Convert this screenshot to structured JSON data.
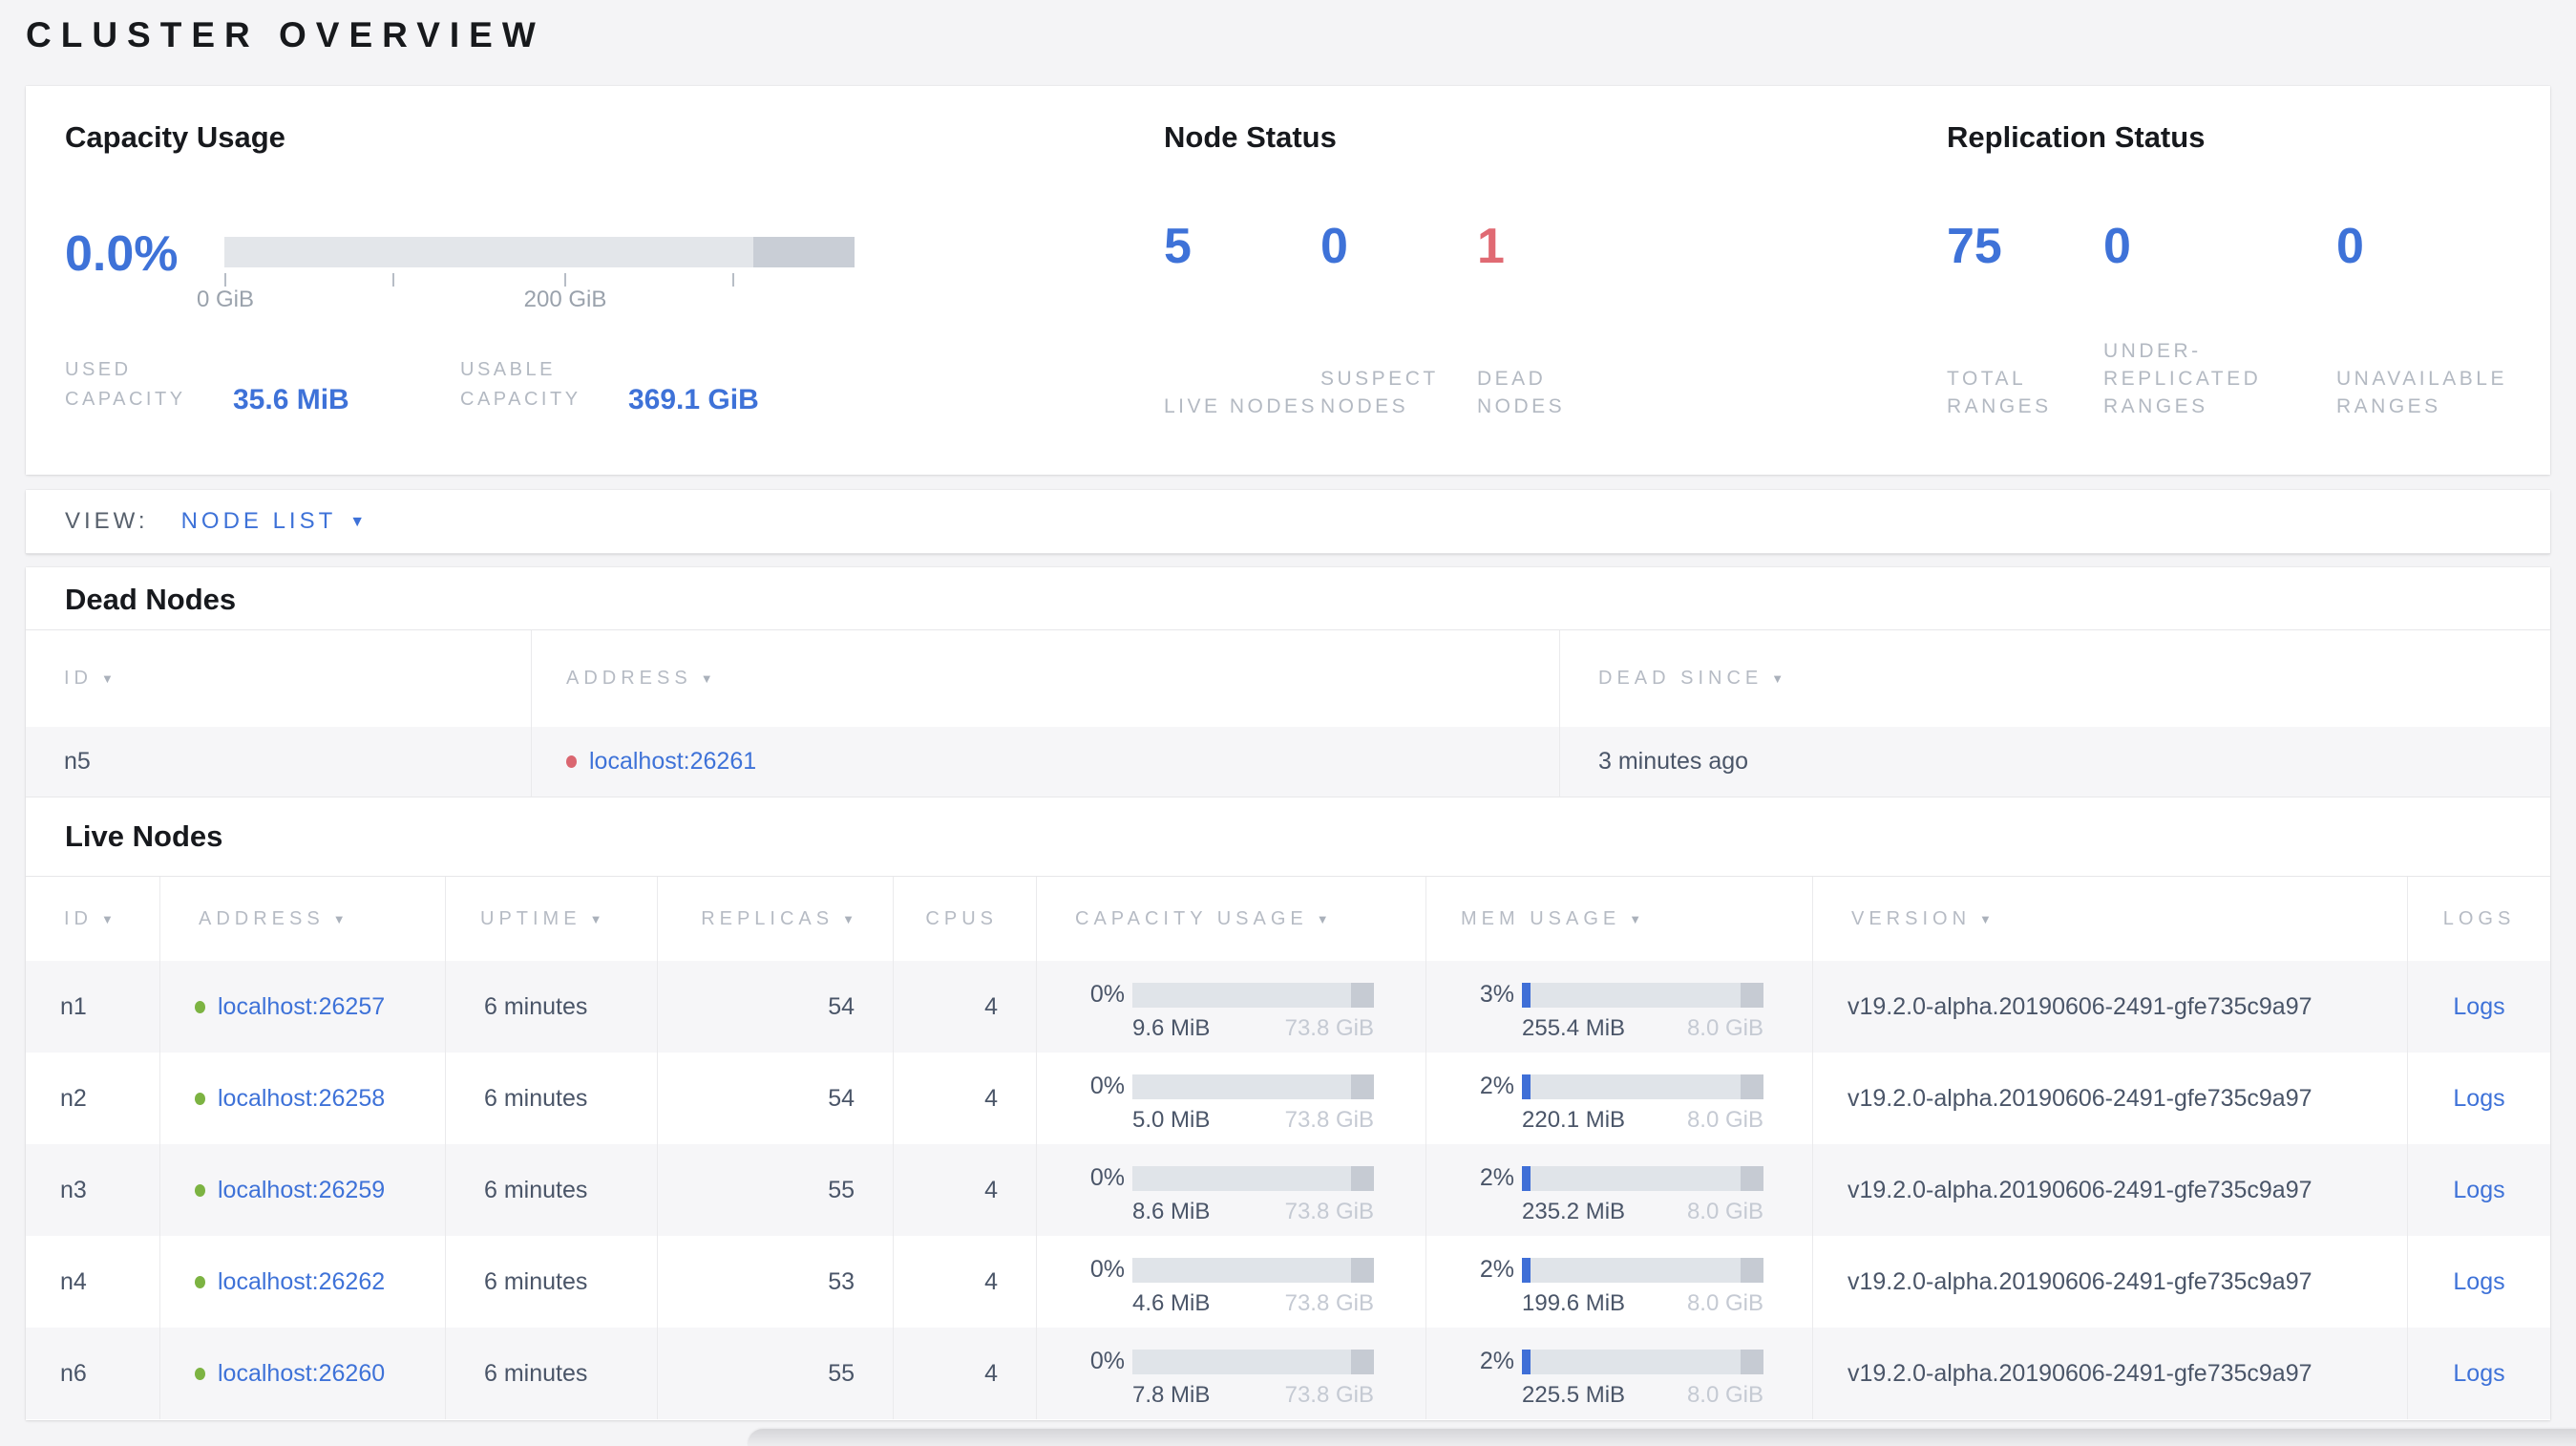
{
  "page": {
    "title": "CLUSTER OVERVIEW"
  },
  "colors": {
    "accent_blue": "#3e72d8",
    "danger_red": "#e06a73",
    "live_dot_green": "#7cb342",
    "dead_dot_red": "#da6670",
    "muted_label_gray": "#b3b9c2",
    "body_slate": "#4a5568",
    "bar_light_gray": "#e3e6ea",
    "bar_dark_gray": "#c9ced6"
  },
  "summary": {
    "capacity": {
      "heading": "Capacity Usage",
      "pct": "0.0%",
      "axis": [
        "0 GiB",
        "200 GiB"
      ],
      "used_label": "USED CAPACITY",
      "used_value": "35.6 MiB",
      "usable_label": "USABLE CAPACITY",
      "usable_value": "369.1 GiB"
    },
    "node_status": {
      "heading": "Node Status",
      "stats": [
        {
          "value": "5",
          "label": "LIVE NODES"
        },
        {
          "value": "0",
          "label": "SUSPECT NODES"
        },
        {
          "value": "1",
          "label": "DEAD NODES"
        }
      ]
    },
    "replication": {
      "heading": "Replication Status",
      "stats": [
        {
          "value": "75",
          "label": "TOTAL RANGES"
        },
        {
          "value": "0",
          "label": "UNDER-REPLICATED RANGES"
        },
        {
          "value": "0",
          "label": "UNAVAILABLE RANGES"
        }
      ]
    }
  },
  "view_bar": {
    "label": "VIEW:",
    "selected": "NODE LIST",
    "caret": "▼"
  },
  "dead_nodes": {
    "title": "Dead Nodes",
    "columns": [
      {
        "label": "ID",
        "arrow": "▼"
      },
      {
        "label": "ADDRESS",
        "arrow": "▼"
      },
      {
        "label": "DEAD SINCE",
        "arrow": "▼"
      }
    ],
    "rows": [
      {
        "id": "n5",
        "address": "localhost:26261",
        "dead_since": "3 minutes ago"
      }
    ]
  },
  "live_nodes": {
    "title": "Live Nodes",
    "columns": [
      {
        "label": "ID",
        "arrow": "▼"
      },
      {
        "label": "ADDRESS",
        "arrow": "▼"
      },
      {
        "label": "UPTIME",
        "arrow": "▼"
      },
      {
        "label": "REPLICAS",
        "arrow": "▼"
      },
      {
        "label": "CPUS"
      },
      {
        "label": "CAPACITY USAGE",
        "arrow": "▼"
      },
      {
        "label": "MEM USAGE",
        "arrow": "▼"
      },
      {
        "label": "VERSION",
        "arrow": "▼"
      },
      {
        "label": "LOGS"
      }
    ],
    "rows": [
      {
        "id": "n1",
        "address": "localhost:26257",
        "uptime": "6 minutes",
        "replicas": "54",
        "cpus": "4",
        "capacity_pct": "0%",
        "capacity_used": "9.6 MiB",
        "capacity_total": "73.8 GiB",
        "mem_pct": "3%",
        "mem_used": "255.4 MiB",
        "mem_total": "8.0 GiB",
        "version": "v19.2.0-alpha.20190606-2491-gfe735c9a97",
        "logs_label": "Logs"
      },
      {
        "id": "n2",
        "address": "localhost:26258",
        "uptime": "6 minutes",
        "replicas": "54",
        "cpus": "4",
        "capacity_pct": "0%",
        "capacity_used": "5.0 MiB",
        "capacity_total": "73.8 GiB",
        "mem_pct": "2%",
        "mem_used": "220.1 MiB",
        "mem_total": "8.0 GiB",
        "version": "v19.2.0-alpha.20190606-2491-gfe735c9a97",
        "logs_label": "Logs"
      },
      {
        "id": "n3",
        "address": "localhost:26259",
        "uptime": "6 minutes",
        "replicas": "55",
        "cpus": "4",
        "capacity_pct": "0%",
        "capacity_used": "8.6 MiB",
        "capacity_total": "73.8 GiB",
        "mem_pct": "2%",
        "mem_used": "235.2 MiB",
        "mem_total": "8.0 GiB",
        "version": "v19.2.0-alpha.20190606-2491-gfe735c9a97",
        "logs_label": "Logs"
      },
      {
        "id": "n4",
        "address": "localhost:26262",
        "uptime": "6 minutes",
        "replicas": "53",
        "cpus": "4",
        "capacity_pct": "0%",
        "capacity_used": "4.6 MiB",
        "capacity_total": "73.8 GiB",
        "mem_pct": "2%",
        "mem_used": "199.6 MiB",
        "mem_total": "8.0 GiB",
        "version": "v19.2.0-alpha.20190606-2491-gfe735c9a97",
        "logs_label": "Logs"
      },
      {
        "id": "n6",
        "address": "localhost:26260",
        "uptime": "6 minutes",
        "replicas": "55",
        "cpus": "4",
        "capacity_pct": "0%",
        "capacity_used": "7.8 MiB",
        "capacity_total": "73.8 GiB",
        "mem_pct": "2%",
        "mem_used": "225.5 MiB",
        "mem_total": "8.0 GiB",
        "version": "v19.2.0-alpha.20190606-2491-gfe735c9a97",
        "logs_label": "Logs"
      }
    ]
  }
}
